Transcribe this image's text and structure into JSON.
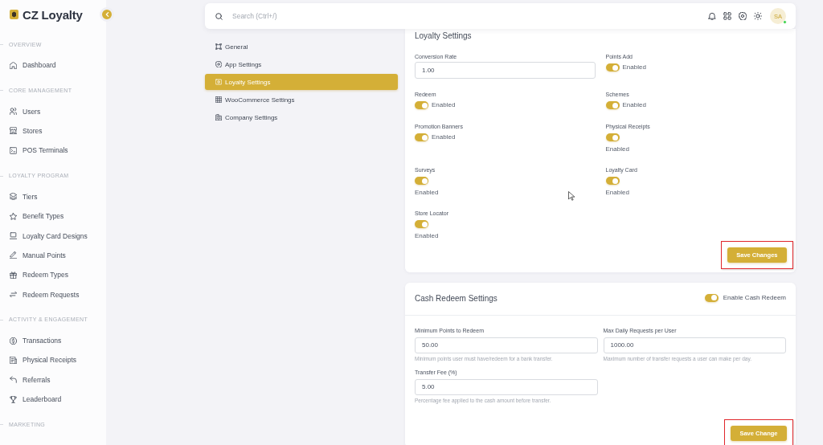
{
  "sidebar": {
    "brand": "CZ Loyalty",
    "sections": [
      {
        "title": "OVERVIEW",
        "items": [
          {
            "label": "Dashboard",
            "selected": false
          }
        ]
      },
      {
        "title": "CORE MANAGEMENT",
        "items": [
          {
            "label": "Users",
            "selected": false
          },
          {
            "label": "Stores",
            "selected": false
          },
          {
            "label": "POS Terminals",
            "selected": false
          }
        ]
      },
      {
        "title": "LOYALTY PROGRAM",
        "items": [
          {
            "label": "Tiers",
            "selected": false
          },
          {
            "label": "Benefit Types",
            "selected": false
          },
          {
            "label": "Loyalty Card Designs",
            "selected": false
          },
          {
            "label": "Manual Points",
            "selected": false
          },
          {
            "label": "Redeem Types",
            "selected": false
          },
          {
            "label": "Redeem Requests",
            "selected": false
          }
        ]
      },
      {
        "title": "ACTIVITY & ENGAGEMENT",
        "items": [
          {
            "label": "Transactions",
            "selected": false
          },
          {
            "label": "Physical Receipts",
            "selected": false
          },
          {
            "label": "Referrals",
            "selected": false
          },
          {
            "label": "Leaderboard",
            "selected": false
          }
        ]
      },
      {
        "title": "MARKETING"
      }
    ]
  },
  "topbar": {
    "search": {
      "placeholder": "Search (Ctrl+/)"
    },
    "user": {
      "initials": "SA",
      "online": true
    }
  },
  "settings_nav": {
    "items": [
      {
        "label": "General",
        "selected": false
      },
      {
        "label": "App Settings",
        "selected": false
      },
      {
        "label": "Loyalty Settings",
        "selected": true
      },
      {
        "label": "WooCommerce Settings",
        "selected": false
      },
      {
        "label": "Company Settings",
        "selected": false
      }
    ]
  },
  "loyalty_settings": {
    "title": "Loyalty Settings",
    "fields": [
      {
        "kind": "input",
        "label": "Conversion Rate",
        "value": "1.00"
      },
      {
        "kind": "inline",
        "label": "Points Add",
        "on": true,
        "status": "Enabled"
      },
      {
        "kind": "inline",
        "label": "Redeem",
        "on": true,
        "status": "Enabled"
      },
      {
        "kind": "inline",
        "label": "Schemes",
        "on": true,
        "status": "Enabled"
      },
      {
        "kind": "inline",
        "label": "Promotion Banners",
        "on": true,
        "status": "Enabled"
      },
      {
        "kind": "stacked",
        "label": "Physical Receipts",
        "on": true,
        "status": "Enabled"
      },
      {
        "kind": "stacked",
        "label": "Surveys",
        "on": true,
        "status": "Enabled"
      },
      {
        "kind": "stacked",
        "label": "Loyalty Card",
        "on": true,
        "status": "Enabled"
      },
      {
        "kind": "stacked",
        "label": "Store Locator",
        "on": true,
        "status": "Enabled"
      }
    ],
    "save_button": {
      "label": "Save Changes",
      "highlighted": true
    }
  },
  "cash_redeem_settings": {
    "title": "Cash Redeem Settings",
    "enable_toggle": {
      "label": "Enable Cash Redeem",
      "on": true
    },
    "fields": [
      {
        "label": "Minimum Points to Redeem",
        "value": "50.00",
        "help": "Minimum points user must have/redeem for a bank transfer."
      },
      {
        "label": "Max Daily Requests per User",
        "value": "1000.00",
        "help": "Maximum number of transfer requests a user can make per day."
      },
      {
        "label": "Transfer Fee (%)",
        "value": "5.00",
        "help": "Percentage fee applied to the cash amount before transfer."
      }
    ],
    "save_button": {
      "label": "Save Change",
      "highlighted": true
    }
  }
}
